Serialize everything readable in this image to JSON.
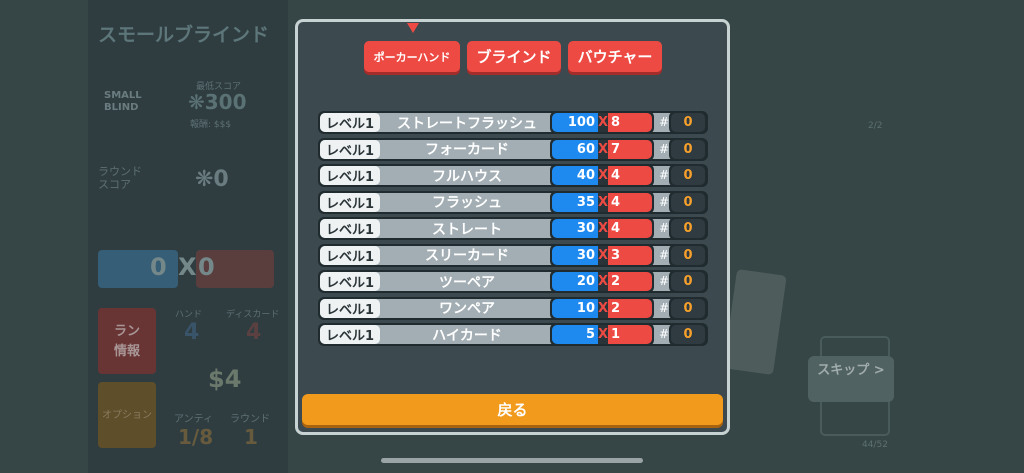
{
  "background": {
    "title": "スモールブラインド",
    "blind_badge": "SMALL BLIND",
    "target_label": "最低スコア",
    "target_score": "❋300",
    "reward": "報酬: $$$",
    "round_score_label": "ラウンド\nスコア",
    "round_score": "❋0",
    "chips_value": "0",
    "mult_value": "0",
    "x": "X",
    "run_info": "ラン\n情報",
    "options": "オプション",
    "hands_label": "ハンド",
    "hands": "4",
    "discards_label": "ディスカード",
    "discards": "4",
    "money": "$4",
    "ante_label": "アンティ",
    "ante": "1/8",
    "round_label": "ラウンド",
    "round": "1",
    "skip_button": "スキップ >",
    "count_top": "2/2",
    "count_bottom": "44/52"
  },
  "modal": {
    "tabs": [
      {
        "label": "ポーカーハンド",
        "selected": true
      },
      {
        "label": "ブラインド",
        "selected": false
      },
      {
        "label": "バウチャー",
        "selected": false
      }
    ],
    "colors": {
      "tab": "#ee4a44",
      "chips": "#1e8af0",
      "mult": "#ee4a44",
      "played": "#f7a02c",
      "back": "#f29a1c"
    },
    "hand_rows": [
      {
        "level": "レベル1",
        "name": "ストレートフラッシュ",
        "chips": "100",
        "mult": "8",
        "played": "0"
      },
      {
        "level": "レベル1",
        "name": "フォーカード",
        "chips": "60",
        "mult": "7",
        "played": "0"
      },
      {
        "level": "レベル1",
        "name": "フルハウス",
        "chips": "40",
        "mult": "4",
        "played": "0"
      },
      {
        "level": "レベル1",
        "name": "フラッシュ",
        "chips": "35",
        "mult": "4",
        "played": "0"
      },
      {
        "level": "レベル1",
        "name": "ストレート",
        "chips": "30",
        "mult": "4",
        "played": "0"
      },
      {
        "level": "レベル1",
        "name": "スリーカード",
        "chips": "30",
        "mult": "3",
        "played": "0"
      },
      {
        "level": "レベル1",
        "name": "ツーペア",
        "chips": "20",
        "mult": "2",
        "played": "0"
      },
      {
        "level": "レベル1",
        "name": "ワンペア",
        "chips": "10",
        "mult": "2",
        "played": "0"
      },
      {
        "level": "レベル1",
        "name": "ハイカード",
        "chips": "5",
        "mult": "1",
        "played": "0"
      }
    ],
    "x_symbol": "X",
    "hash_symbol": "#",
    "back_button": "戻る"
  }
}
